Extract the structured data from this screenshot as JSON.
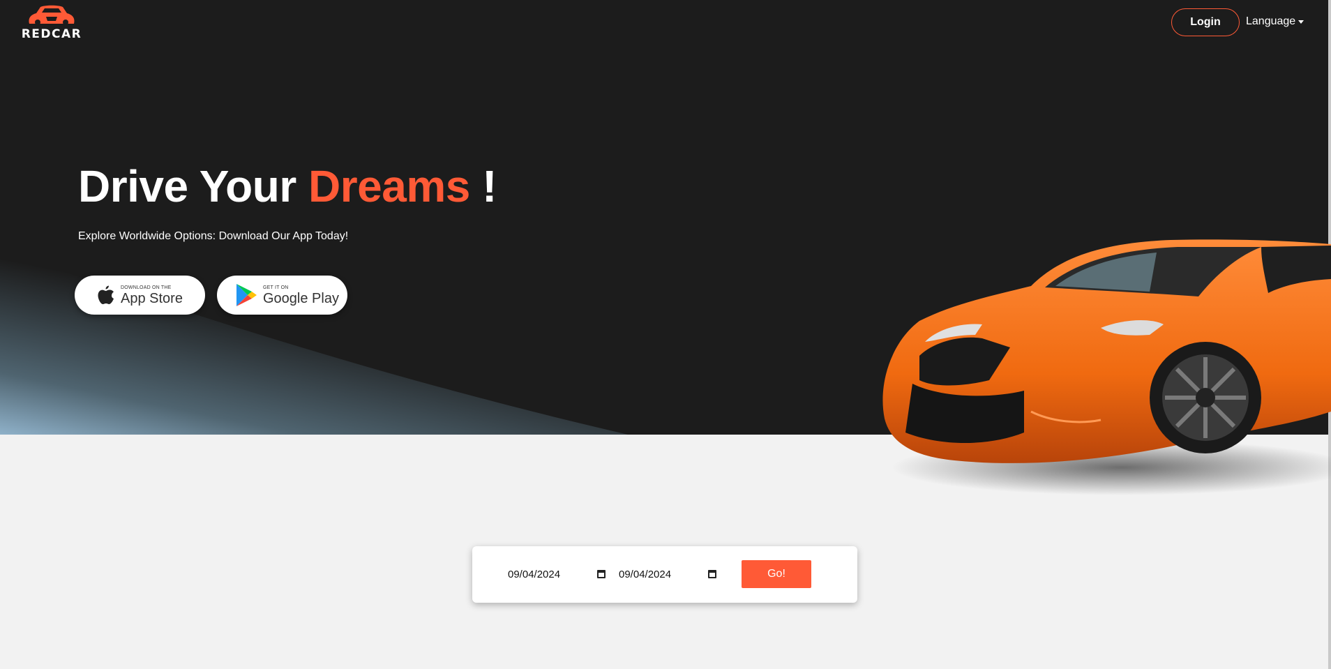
{
  "brand": {
    "name": "REDCAR"
  },
  "nav": {
    "login_label": "Login",
    "language_label": "Language"
  },
  "hero": {
    "headline_part1": "Drive Your ",
    "headline_accent": "Dreams",
    "headline_part2": " !",
    "subheadline": "Explore Worldwide Options: Download Our App Today!"
  },
  "app_store": {
    "small_text": "Download on the",
    "big_text": "App Store"
  },
  "google_play": {
    "small_text": "GET IT ON",
    "big_text": "Google Play"
  },
  "booking": {
    "start_date": "09/04/2024",
    "end_date": "09/04/2024",
    "submit_label": "Go!"
  },
  "colors": {
    "accent": "#ff5a36",
    "hero_bg": "#1c1c1c",
    "page_bg": "#f2f2f2"
  },
  "icons": [
    "redcar-logo-icon",
    "apple-icon",
    "google-play-icon",
    "calendar-icon",
    "chevron-down-icon"
  ]
}
